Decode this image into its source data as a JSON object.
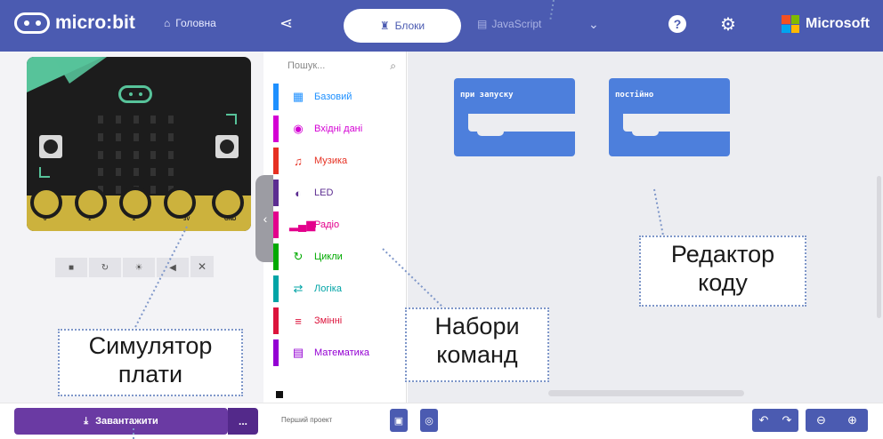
{
  "header": {
    "logo_text": "micro:bit",
    "home_label": "Головна",
    "share_icon": "share-icon",
    "tabs": {
      "blocks": "Блоки",
      "javascript": "JavaScript"
    },
    "brand": "Microsoft",
    "colors": {
      "bar": "#4b5bb1",
      "ms_red": "#f25022",
      "ms_green": "#7fba00",
      "ms_blue": "#00a4ef",
      "ms_yellow": "#ffb900"
    }
  },
  "simulator": {
    "pins": [
      "0",
      "1",
      "2",
      "3V",
      "GND"
    ],
    "controls": [
      "■",
      "↻",
      "☀",
      "◀",
      "✕"
    ]
  },
  "toolbox": {
    "search_placeholder": "Пошук...",
    "categories": [
      {
        "label": "Базовий",
        "color": "#1e90ff",
        "icon": "grid-icon",
        "glyph": "▦"
      },
      {
        "label": "Вхідні дані",
        "color": "#d400d4",
        "icon": "target-icon",
        "glyph": "◉"
      },
      {
        "label": "Музика",
        "color": "#e63022",
        "icon": "headphones-icon",
        "glyph": "♫"
      },
      {
        "label": "LED",
        "color": "#5c2d91",
        "icon": "toggle-icon",
        "glyph": "◐"
      },
      {
        "label": "Радіо",
        "color": "#e3008c",
        "icon": "signal-icon",
        "glyph": "▂▄▆"
      },
      {
        "label": "Цикли",
        "color": "#00aa00",
        "icon": "loop-icon",
        "glyph": "↻"
      },
      {
        "label": "Логіка",
        "color": "#00a4a6",
        "icon": "shuffle-icon",
        "glyph": "⇄"
      },
      {
        "label": "Змінні",
        "color": "#dc143c",
        "icon": "list-icon",
        "glyph": "≡"
      },
      {
        "label": "Математика",
        "color": "#9400d3",
        "icon": "calculator-icon",
        "glyph": "▤"
      }
    ]
  },
  "workspace": {
    "blocks": [
      {
        "label": "при запуску"
      },
      {
        "label": "постійно"
      }
    ]
  },
  "footer": {
    "download_label": "Завантажити",
    "more_label": "...",
    "project_name_placeholder": "Перший проект"
  },
  "callouts": {
    "simulator": [
      "Симулятор",
      "плати"
    ],
    "blocks": [
      "Набори",
      "команд"
    ],
    "editor": [
      "Редактор",
      "коду"
    ]
  }
}
